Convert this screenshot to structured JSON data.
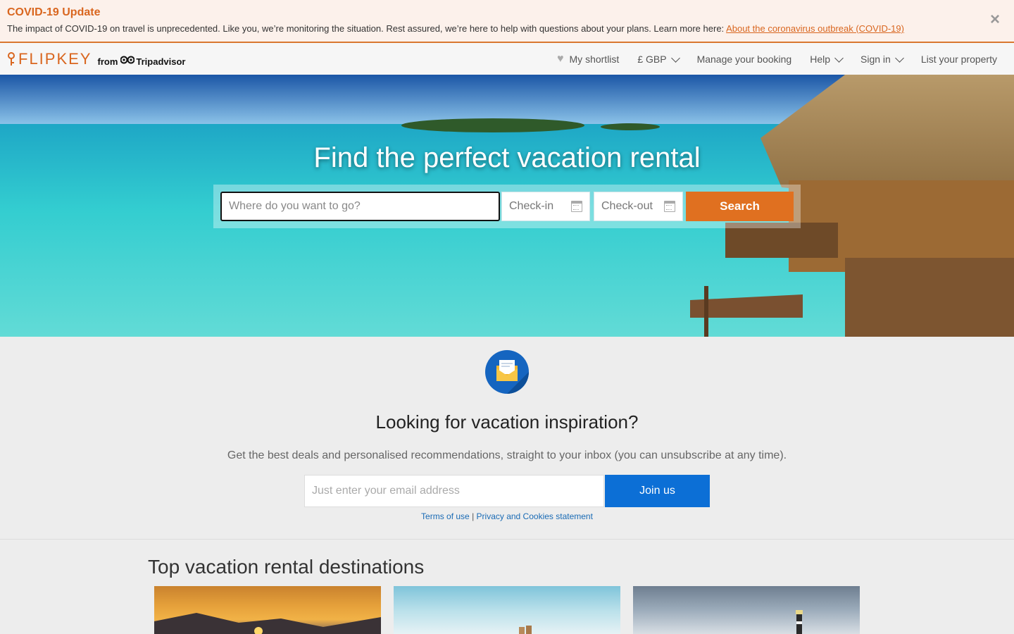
{
  "banner": {
    "title": "COVID-19 Update",
    "text": "The impact of COVID-19 on travel is unprecedented. Like you, we’re monitoring the situation. Rest assured, we’re here to help with questions about your plans. Learn more here: ",
    "link": "About the coronavirus outbreak (COVID-19)",
    "close": "×"
  },
  "header": {
    "logo": "FLIPKEY",
    "from": "from",
    "tripadvisor": "Tripadvisor",
    "nav": {
      "shortlist": "My shortlist",
      "currency": "£ GBP",
      "manage": "Manage your booking",
      "help": "Help",
      "signin": "Sign in",
      "list": "List your property"
    }
  },
  "hero": {
    "title": "Find the perfect vacation rental",
    "where_placeholder": "Where do you want to go?",
    "checkin": "Check-in",
    "checkout": "Check-out",
    "search": "Search"
  },
  "newsletter": {
    "title": "Looking for vacation inspiration?",
    "subtitle": "Get the best deals and personalised recommendations, straight to your inbox (you can unsubscribe at any time).",
    "email_placeholder": "Just enter your email address",
    "join": "Join us",
    "terms": "Terms of use",
    "separator": " | ",
    "privacy": "Privacy and Cookies statement"
  },
  "destinations": {
    "title": "Top vacation rental destinations"
  },
  "colors": {
    "accent": "#e07020",
    "brand_orange": "#d9661f",
    "join_blue": "#0c6fd6"
  }
}
